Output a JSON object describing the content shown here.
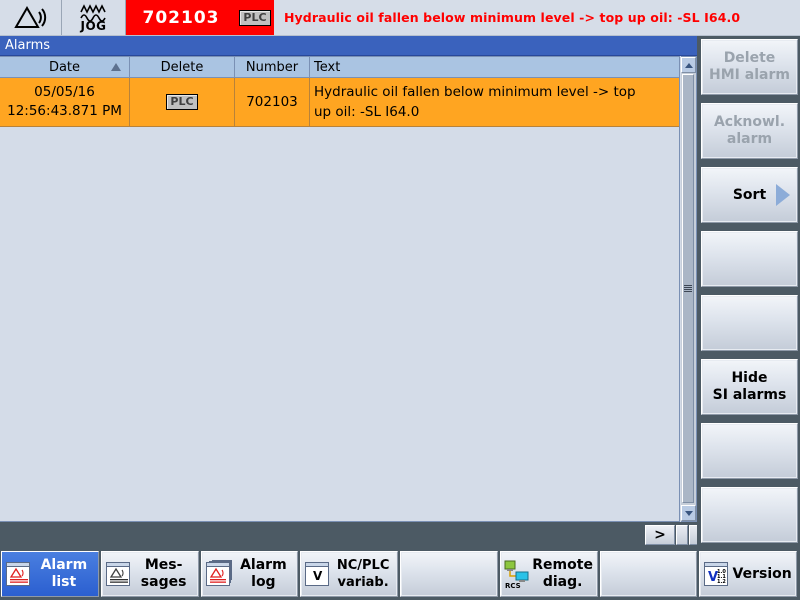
{
  "statusbar": {
    "alarm_icon": "alarm-triangle-icon",
    "mode_icon": "jog-wave-icon",
    "mode_label": "JOG",
    "alarm_number": "702103",
    "alarm_source_badge": "PLC",
    "alarm_text": "Hydraulic oil fallen below minimum level  -> top up oil: -SL I64.0",
    "alarm_bg_color": "#ff0000",
    "alarm_text_color": "#ff0000"
  },
  "window": {
    "title": "Alarms"
  },
  "table": {
    "columns": [
      "Date",
      "Delete",
      "Number",
      "Text"
    ],
    "sort_indicator": "ascending-sort-arrow",
    "rows": [
      {
        "date": "05/05/16",
        "time": "12:56:43.871 PM",
        "delete": "PLC",
        "number": "702103",
        "text_line1": "Hydraulic oil fallen below minimum level  -> top",
        "text_line2": "up oil: -SL I64.0",
        "row_color": "#ffa521"
      }
    ]
  },
  "scrollbar": {
    "up_arrow": "chevron-up-icon",
    "down_arrow": "chevron-down-icon",
    "page_right": ">"
  },
  "vertical_softkeys": [
    {
      "label": "Delete\nHMI alarm",
      "line1": "Delete",
      "line2": "HMI alarm",
      "enabled": false,
      "arrow": false
    },
    {
      "label": "Acknowl.\nalarm",
      "line1": "Acknowl.",
      "line2": "alarm",
      "enabled": false,
      "arrow": false
    },
    {
      "label": "Sort",
      "line1": "Sort",
      "line2": "",
      "enabled": true,
      "arrow": true
    },
    {
      "label": "",
      "line1": "",
      "line2": "",
      "enabled": true,
      "arrow": false
    },
    {
      "label": "",
      "line1": "",
      "line2": "",
      "enabled": true,
      "arrow": false
    },
    {
      "label": "Hide\nSI alarms",
      "line1": "Hide",
      "line2": "SI alarms",
      "enabled": true,
      "arrow": false
    },
    {
      "label": "",
      "line1": "",
      "line2": "",
      "enabled": true,
      "arrow": false
    },
    {
      "label": "",
      "line1": "",
      "line2": "",
      "enabled": true,
      "arrow": false
    }
  ],
  "horizontal_softkeys": [
    {
      "line1": "Alarm",
      "line2": "list",
      "icon": "alarm-list-icon",
      "active": true
    },
    {
      "line1": "Mes-",
      "line2": "sages",
      "icon": "messages-icon",
      "active": false
    },
    {
      "line1": "Alarm",
      "line2": "log",
      "icon": "alarm-log-icon",
      "active": false
    },
    {
      "line1": "NC/PLC",
      "line2": "variab.",
      "icon": "variables-icon",
      "active": false
    },
    {
      "line1": "",
      "line2": "",
      "icon": "",
      "active": false
    },
    {
      "line1": "Remote",
      "line2": "diag.",
      "icon": "rcs-remote-icon",
      "active": false
    },
    {
      "line1": "",
      "line2": "",
      "icon": "",
      "active": false
    },
    {
      "line1": "Version",
      "line2": "",
      "icon": "version-icon",
      "active": false
    }
  ],
  "colors": {
    "accent_blue": "#3a62bd",
    "alarm_row": "#ffa521",
    "header_row": "#aac4e2",
    "background": "#d4dce8",
    "softkey_bar": "#4c5a64"
  }
}
